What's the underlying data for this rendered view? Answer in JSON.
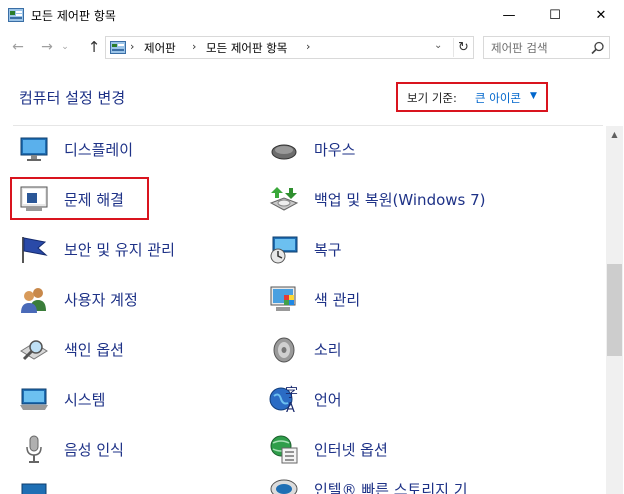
{
  "window": {
    "title": "모든 제어판 항목",
    "minimize": "—",
    "maximize": "☐",
    "close": "✕"
  },
  "nav": {
    "back": "←",
    "forward": "→",
    "recent": "⌄",
    "up": "↑",
    "breadcrumbs": [
      "제어판",
      "모든 제어판 항목"
    ],
    "separator": "›",
    "dropdown": "⌄",
    "refresh": "↻"
  },
  "search": {
    "placeholder": "제어판 검색"
  },
  "header": {
    "title": "컴퓨터 설정 변경",
    "view_by_label": "보기 기준:",
    "view_by_value": "큰 아이콘",
    "view_by_caret": "▼"
  },
  "items": [
    {
      "label": "디스플레이",
      "icon": "display-icon"
    },
    {
      "label": "마우스",
      "icon": "mouse-icon"
    },
    {
      "label": "문제 해결",
      "icon": "troubleshooting-icon"
    },
    {
      "label": "백업 및 복원(Windows 7)",
      "icon": "backup-restore-icon"
    },
    {
      "label": "보안 및 유지 관리",
      "icon": "security-flag-icon"
    },
    {
      "label": "복구",
      "icon": "recovery-icon"
    },
    {
      "label": "사용자 계정",
      "icon": "user-accounts-icon"
    },
    {
      "label": "색 관리",
      "icon": "color-management-icon"
    },
    {
      "label": "색인 옵션",
      "icon": "indexing-options-icon"
    },
    {
      "label": "소리",
      "icon": "sound-icon"
    },
    {
      "label": "시스템",
      "icon": "system-icon"
    },
    {
      "label": "언어",
      "icon": "language-icon"
    },
    {
      "label": "음성 인식",
      "icon": "speech-recognition-icon"
    },
    {
      "label": "인터넷 옵션",
      "icon": "internet-options-icon"
    },
    {
      "label": "인텔® 빠른 스토리지 기",
      "icon": "intel-storage-icon"
    }
  ],
  "colors": {
    "link": "#1e3287",
    "accent": "#0066cc",
    "highlight": "#d9141e"
  }
}
